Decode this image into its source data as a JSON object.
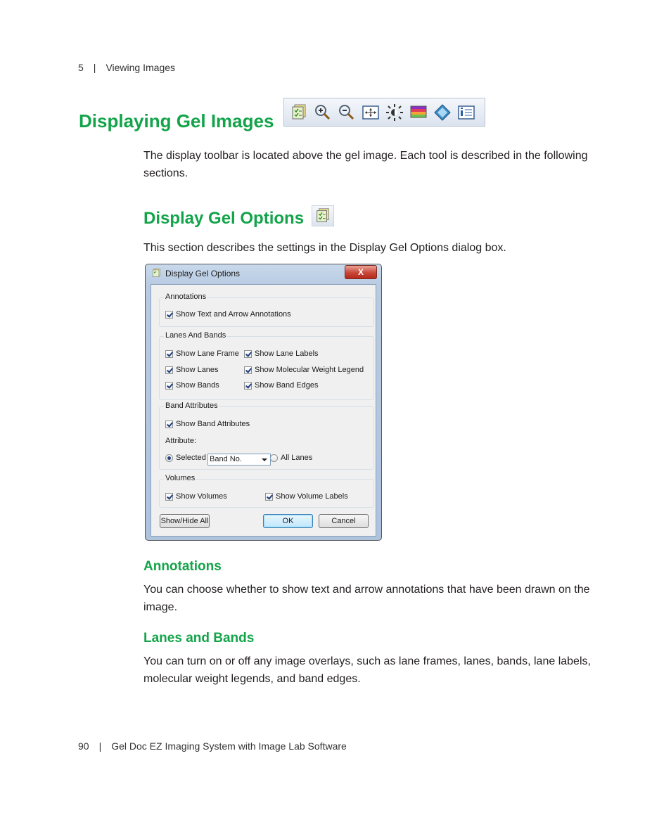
{
  "header": {
    "chapter_number": "5",
    "chapter_title": "Viewing Images"
  },
  "page_title": "Displaying Gel Images",
  "toolbar": {
    "icons": [
      "display-options-icon",
      "zoom-in-icon",
      "zoom-out-icon",
      "fit-window-icon",
      "brightness-icon",
      "color-palette-icon",
      "pen-annotation-icon",
      "image-info-icon"
    ]
  },
  "intro": "The display toolbar is located above the gel image. Each tool is described in the following sections.",
  "section_title": "Display Gel Options",
  "section_intro": "This section describes the settings in the Display Gel Options dialog box.",
  "dialog": {
    "title": "Display Gel Options",
    "close_label": "X",
    "annotations": {
      "label": "Annotations",
      "show_text_arrow": "Show Text and Arrow Annotations"
    },
    "lanes_bands": {
      "label": "Lanes And Bands",
      "show_lane_frame": "Show Lane Frame",
      "show_lane_labels": "Show Lane Labels",
      "show_lanes": "Show Lanes",
      "show_mw_legend": "Show Molecular Weight Legend",
      "show_bands": "Show Bands",
      "show_band_edges": "Show Band Edges"
    },
    "band_attributes": {
      "label": "Band Attributes",
      "show_band_attributes": "Show Band Attributes",
      "attribute_label": "Attribute:",
      "attribute_value": "Band No.",
      "selected_lane_only": "Selected Lane Only",
      "all_lanes": "All Lanes"
    },
    "volumes": {
      "label": "Volumes",
      "show_volumes": "Show Volumes",
      "show_volume_labels": "Show Volume Labels"
    },
    "buttons": {
      "show_hide_all": "Show/Hide All",
      "ok": "OK",
      "cancel": "Cancel"
    }
  },
  "annotations_section": {
    "title": "Annotations",
    "text": "You can choose whether to show text and arrow annotations that have been drawn on the image."
  },
  "lanes_section": {
    "title": "Lanes and Bands",
    "text": "You can turn on or off any image overlays, such as lane frames, lanes, bands, lane labels, molecular weight legends, and band edges."
  },
  "footer": {
    "page_number": "90",
    "book_title": "Gel Doc EZ Imaging System with Image Lab Software"
  }
}
